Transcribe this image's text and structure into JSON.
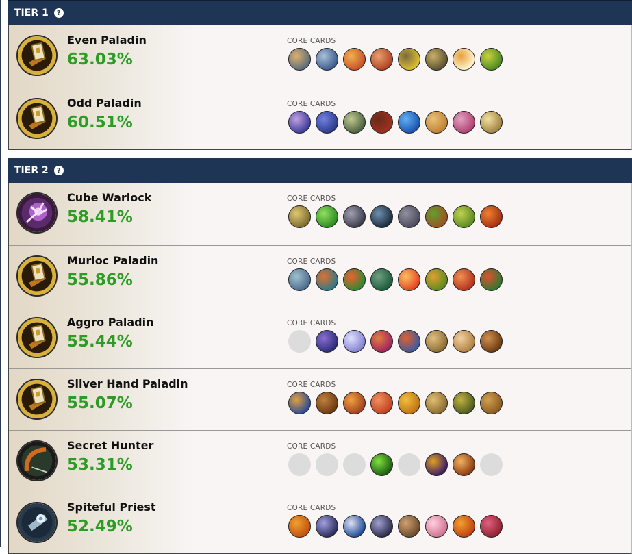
{
  "tiers": [
    {
      "label": "TIER 1",
      "help_icon": "question-circle-icon",
      "decks": [
        {
          "name": "Even Paladin",
          "winrate": "63.03%",
          "core_label": "CORE CARDS",
          "class_icon": "paladin-hammer-icon",
          "cards": [
            [
              "#5a6b7a",
              "#d9b070"
            ],
            [
              "#3c5a8c",
              "#a8c0d8"
            ],
            [
              "#c8502a",
              "#f0b050"
            ],
            [
              "#b04020",
              "#e8a070"
            ],
            [
              "#e0c030",
              "#7a6a40"
            ],
            [
              "#5a5030",
              "#c8b068"
            ],
            [
              "#fff6d0",
              "#e8a040"
            ],
            [
              "#4a8a20",
              "#c8d040"
            ]
          ]
        },
        {
          "name": "Odd Paladin",
          "winrate": "60.51%",
          "core_label": "CORE CARDS",
          "class_icon": "paladin-hammer-icon",
          "cards": [
            [
              "#3a3a9a",
              "#c0a0e0"
            ],
            [
              "#2a3a8a",
              "#7080e0"
            ],
            [
              "#4a6040",
              "#c0c890"
            ],
            [
              "#a03020",
              "#6a2a18"
            ],
            [
              "#1a50b0",
              "#60b0f0"
            ],
            [
              "#c08030",
              "#e8c078"
            ],
            [
              "#b04070",
              "#e0a0c0"
            ],
            [
              "#a08040",
              "#f0e0a0"
            ]
          ]
        }
      ]
    },
    {
      "label": "TIER 2",
      "help_icon": "question-circle-icon",
      "decks": [
        {
          "name": "Cube Warlock",
          "winrate": "58.41%",
          "core_label": "CORE CARDS",
          "class_icon": "warlock-hand-icon",
          "cards": [
            [
              "#7a6a30",
              "#e0c870"
            ],
            [
              "#2a8a20",
              "#90e060"
            ],
            [
              "#3a3a4a",
              "#a0a0b0"
            ],
            [
              "#1a2a3a",
              "#7090b0"
            ],
            [
              "#4a4a5a",
              "#9090a0"
            ],
            [
              "#a05020",
              "#60a030"
            ],
            [
              "#5a8a20",
              "#c0d050"
            ],
            [
              "#a03010",
              "#f08030"
            ]
          ]
        },
        {
          "name": "Murloc Paladin",
          "winrate": "55.86%",
          "core_label": "CORE CARDS",
          "class_icon": "paladin-hammer-icon",
          "cards": [
            [
              "#4a6a8a",
              "#a0c0d0"
            ],
            [
              "#2a7a8a",
              "#e07030"
            ],
            [
              "#2a8a30",
              "#f06030"
            ],
            [
              "#1a5a3a",
              "#70a080"
            ],
            [
              "#e04020",
              "#ffc060"
            ],
            [
              "#5a8a20",
              "#e0a030"
            ],
            [
              "#b03020",
              "#f09050"
            ],
            [
              "#2a7a30",
              "#e05030"
            ]
          ]
        },
        {
          "name": "Aggro Paladin",
          "winrate": "55.44%",
          "core_label": "CORE CARDS",
          "class_icon": "paladin-hammer-icon",
          "cards": [
            "empty",
            [
              "#2a2a7a",
              "#8a70d0"
            ],
            [
              "#8080d0",
              "#e0e0ff"
            ],
            [
              "#a02060",
              "#e08040"
            ],
            [
              "#3a5aa0",
              "#e06030"
            ],
            [
              "#8a6a30",
              "#e0c080"
            ],
            [
              "#b08040",
              "#f0d0a0"
            ],
            [
              "#6a3a10",
              "#d09050"
            ]
          ]
        },
        {
          "name": "Silver Hand Paladin",
          "winrate": "55.07%",
          "core_label": "CORE CARDS",
          "class_icon": "paladin-hammer-icon",
          "cards": [
            [
              "#2a4a9a",
              "#e0a040"
            ],
            [
              "#6a3a10",
              "#c08040"
            ],
            [
              "#a04020",
              "#f0a040"
            ],
            [
              "#c04020",
              "#f09060"
            ],
            [
              "#c07010",
              "#f0c040"
            ],
            [
              "#8a6a30",
              "#e0c070"
            ],
            [
              "#4a5a20",
              "#c0b040"
            ],
            [
              "#8a5a20",
              "#d0a050"
            ]
          ]
        },
        {
          "name": "Secret Hunter",
          "winrate": "53.31%",
          "core_label": "CORE CARDS",
          "class_icon": "hunter-bow-icon",
          "cards": [
            "empty",
            "empty",
            "empty",
            [
              "#1a5a10",
              "#80e040"
            ],
            "empty",
            [
              "#3a1a6a",
              "#e0a020"
            ],
            [
              "#8a3a10",
              "#f0b060"
            ],
            "empty"
          ]
        },
        {
          "name": "Spiteful Priest",
          "winrate": "52.49%",
          "core_label": "CORE CARDS",
          "class_icon": "priest-staff-icon",
          "cards": [
            [
              "#c05010",
              "#f0a030"
            ],
            [
              "#2a2a5a",
              "#a0a0e0"
            ],
            [
              "#1a4a9a",
              "#e0e0f0"
            ],
            [
              "#2a2a4a",
              "#a0a0d0"
            ],
            [
              "#6a4a2a",
              "#d0a070"
            ],
            [
              "#d07090",
              "#ffd0e0"
            ],
            [
              "#c04010",
              "#f0a030"
            ],
            [
              "#902030",
              "#e06080"
            ]
          ]
        }
      ]
    }
  ]
}
